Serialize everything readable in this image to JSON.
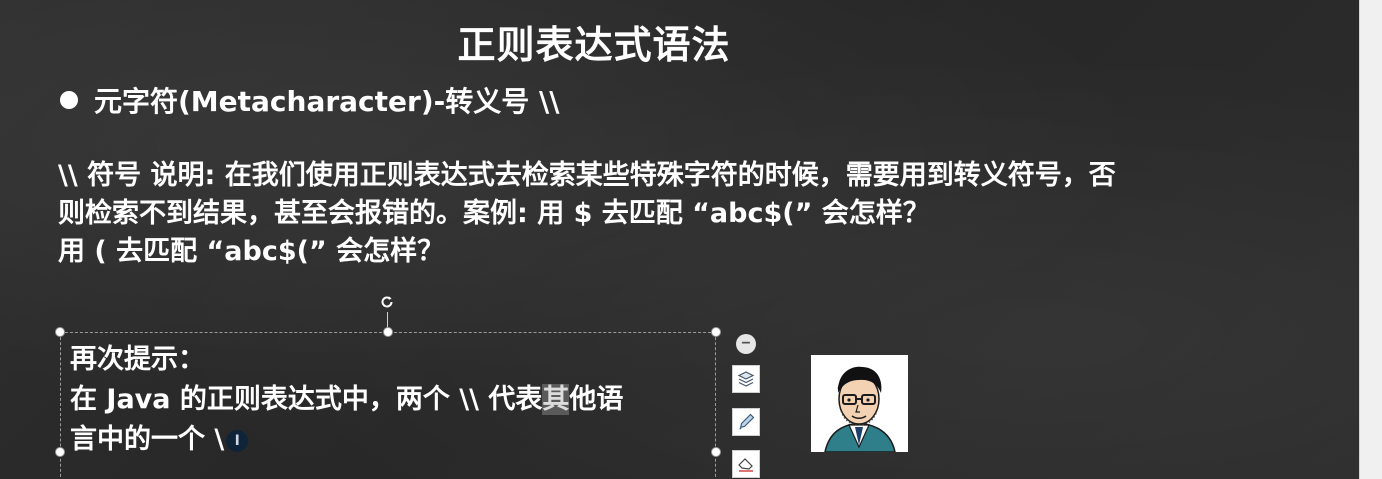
{
  "slide": {
    "title": "正则表达式语法",
    "bullet": "元字符(Metacharacter)-转义号 \\\\",
    "description_lines": [
      "\\\\ 符号 说明: 在我们使用正则表达式去检索某些特殊字符的时候，需要用到转义符号，否",
      "则检索不到结果，甚至会报错的。案例: 用 $  去匹配 “abc$(” 会怎样？",
      "用 (  去匹配 “abc$(” 会怎样？"
    ]
  },
  "hint_box": {
    "line1": "再次提示：",
    "line2_before": "在 Java 的正则表达式中，两个 \\\\ 代表",
    "line2_highlight": "其",
    "line2_after": "他语",
    "line3": "言中的一个 \\",
    "cursor_glyph": "I"
  },
  "toolbar": {
    "icons": [
      "minus-icon",
      "layers-icon",
      "pen-icon",
      "eraser-icon"
    ]
  },
  "colors": {
    "text": "#ffffff",
    "highlight": "#5a5a5a",
    "cursor": "#0f2438"
  }
}
